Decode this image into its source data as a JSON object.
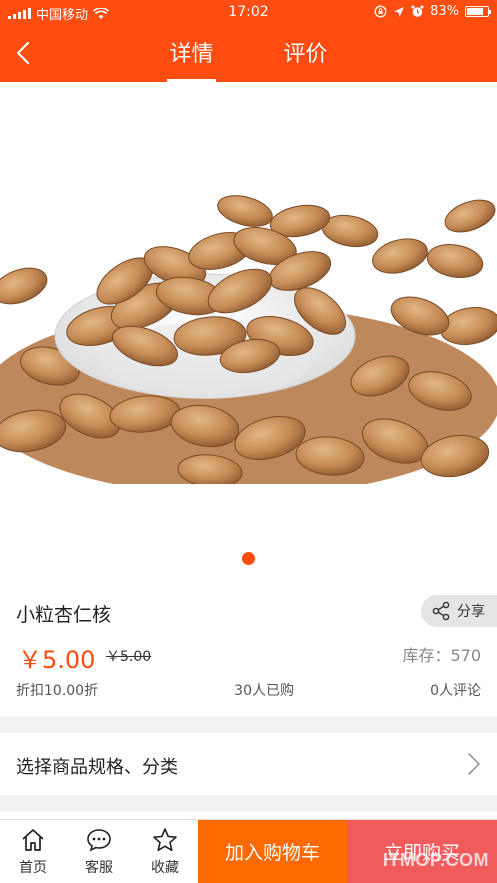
{
  "status_bar": {
    "carrier": "中国移动",
    "time": "17:02",
    "battery": "83%"
  },
  "nav": {
    "back_icon": "chevron-left-icon",
    "tabs": [
      {
        "label": "详情",
        "active": true
      },
      {
        "label": "评价",
        "active": false
      }
    ]
  },
  "gallery": {
    "image": "apricot-kernels-in-bowl",
    "dots": 1,
    "active_dot": 0
  },
  "product": {
    "title": "小粒杏仁核",
    "share_label": "分享",
    "price": "￥5.00",
    "original_price": "￥5.00",
    "stock": "库存：570",
    "discount": "折扣10.00折",
    "sold": "30人已购",
    "reviews": "0人评论"
  },
  "spec": {
    "label": "选择商品规格、分类"
  },
  "bottom_bar": {
    "home_label": "首页",
    "service_label": "客服",
    "favorite_label": "收藏",
    "cart_label": "加入购物车",
    "buy_label": "立即购买",
    "watermark": "ITMOP.COM"
  },
  "colors": {
    "brand": "#ff4d12",
    "cart_button": "#ff6a00",
    "buy_button": "#f25b5b"
  }
}
